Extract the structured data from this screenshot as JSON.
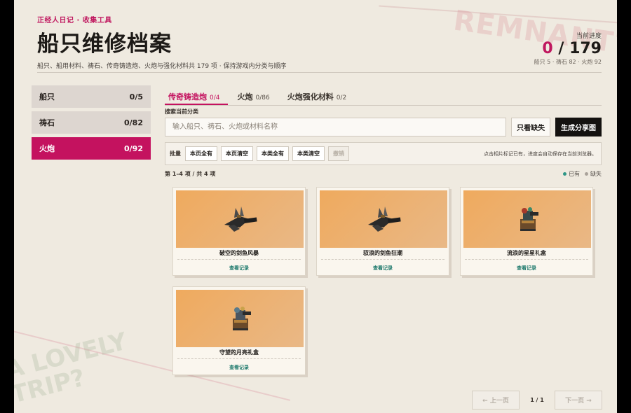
{
  "header": {
    "breadcrumb": "正经人日记 · 收集工具",
    "title": "船只维修档案",
    "subtitle": "船只、船用材料、祷石、传奇铸造炮、火炮与强化材料共 179 项 · 保持游戏内分类与顺序",
    "progress_label": "当前进度",
    "progress_current": "0",
    "progress_sep": " / ",
    "progress_total": "179",
    "progress_detail": "船只 5 · 祷石 82 · 火炮 92"
  },
  "watermarks": {
    "top": "REMNANT?",
    "bottom_1": "A LOVELY",
    "bottom_2": "TRIP?"
  },
  "sidebar": {
    "items": [
      {
        "label": "船只",
        "count": "0/5",
        "active": false
      },
      {
        "label": "祷石",
        "count": "0/82",
        "active": false
      },
      {
        "label": "火炮",
        "count": "0/92",
        "active": true
      }
    ]
  },
  "tabs": [
    {
      "label": "传奇铸造炮",
      "count": "0/4",
      "active": true
    },
    {
      "label": "火炮",
      "count": "0/86",
      "active": false
    },
    {
      "label": "火炮强化材料",
      "count": "0/2",
      "active": false
    }
  ],
  "search": {
    "label": "搜索当前分类",
    "placeholder": "输入船只、祷石、火炮或材料名称",
    "missing_button": "只看缺失",
    "share_button": "生成分享图"
  },
  "bulk": {
    "label": "批量",
    "buttons": [
      "本页全有",
      "本页清空",
      "本类全有",
      "本类清空"
    ],
    "undo": "撤销",
    "hint": "点击相片标记已有，进度会自动保存在当前浏览器。"
  },
  "list": {
    "count_text": "第 1–4 项 / 共 4 项",
    "legend_have": "已有",
    "legend_missing": "缺失"
  },
  "cards": [
    {
      "name": "破空的剑鱼风暴",
      "link": "查看记录",
      "icon": "swordfish-cannon-icon"
    },
    {
      "name": "驭浪的剑鱼狂潮",
      "link": "查看记录",
      "icon": "swordfish-cannon-icon"
    },
    {
      "name": "流浪的星星礼盒",
      "link": "查看记录",
      "icon": "gift-box-cannon-icon"
    },
    {
      "name": "守望的月亮礼盒",
      "link": "查看记录",
      "icon": "gift-box-cannon-icon"
    }
  ],
  "pager": {
    "prev": "← 上一页",
    "info": "1 / 1",
    "next": "下一页 →"
  },
  "colors": {
    "accent": "#c4125f",
    "have": "#2e9686",
    "dark_button": "#141210"
  }
}
